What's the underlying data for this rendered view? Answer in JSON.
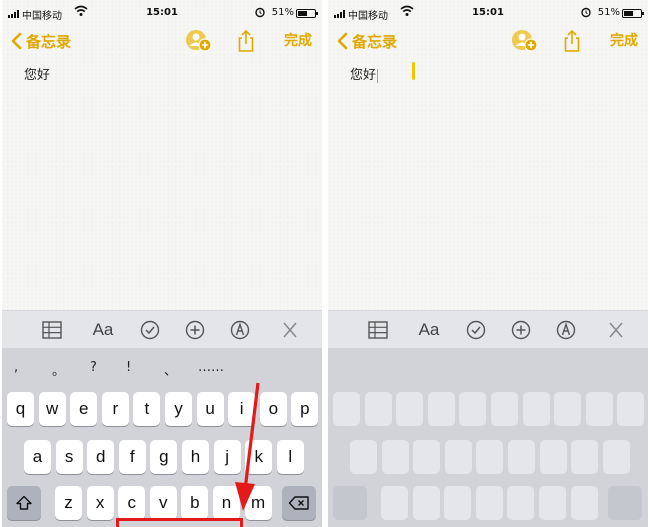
{
  "status": {
    "carrier": "中国移动",
    "time": "15:01",
    "battery": "51%"
  },
  "nav": {
    "back_label": "备忘录",
    "done_label": "完成"
  },
  "note": {
    "text": "您好"
  },
  "toolbar": {
    "format_label": "Aa"
  },
  "candidates": [
    ",",
    "。",
    "?",
    "!",
    "、",
    "……"
  ],
  "keyboard": {
    "row1": [
      "q",
      "w",
      "e",
      "r",
      "t",
      "y",
      "u",
      "i",
      "o",
      "p"
    ],
    "row2": [
      "a",
      "s",
      "d",
      "f",
      "g",
      "h",
      "j",
      "k",
      "l"
    ],
    "row3": [
      "z",
      "x",
      "c",
      "v",
      "b",
      "n",
      "m"
    ]
  },
  "colors": {
    "accent": "#e0a800",
    "annotation": "#e41a1a"
  }
}
